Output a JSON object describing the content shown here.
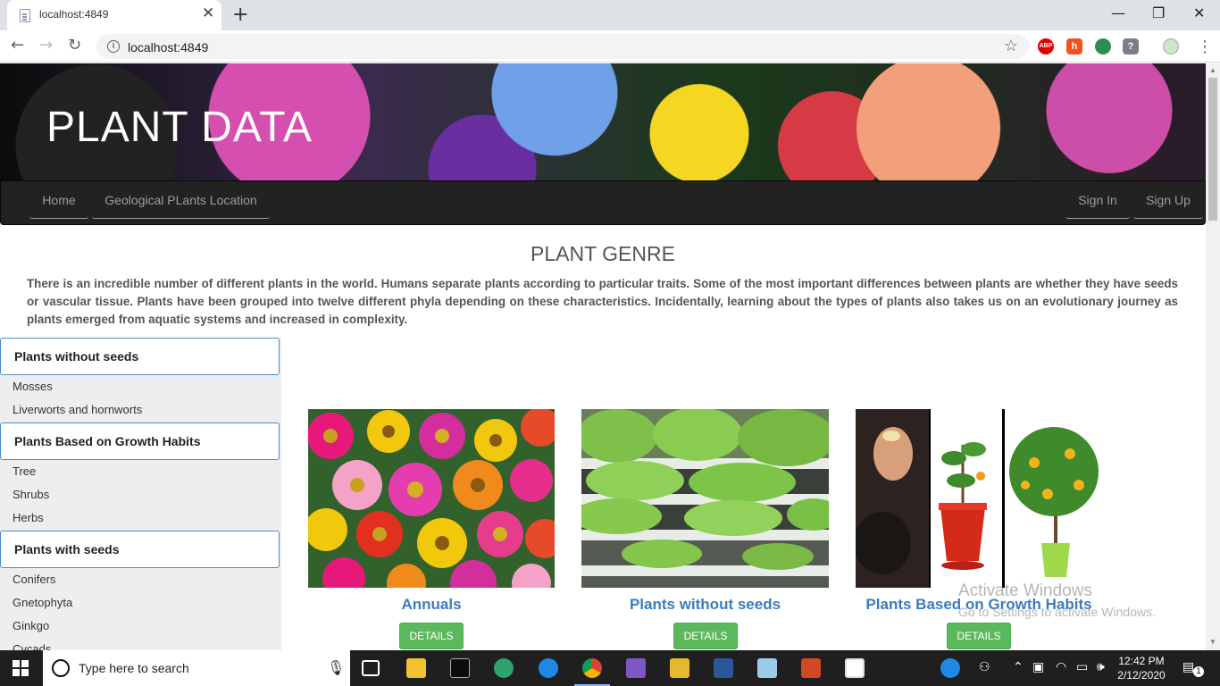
{
  "browser": {
    "tab_title": "localhost:4849",
    "url": "localhost:4849",
    "tab_close": "✕",
    "new_tab": "+",
    "back": "←",
    "forward": "→",
    "reload": "↻",
    "star": "☆",
    "menu": "⋮",
    "minimize": "—",
    "maximize": "❐",
    "close": "✕",
    "extensions": [
      {
        "name": "abp-icon",
        "label": "ABP",
        "color": "#e20000"
      },
      {
        "name": "honey-icon",
        "label": "h",
        "color": "#f4511e"
      },
      {
        "name": "globe-extension-icon",
        "label": "",
        "color": "#2e8b57"
      },
      {
        "name": "shield-extension-icon",
        "label": "?",
        "color": "#7a7f87"
      }
    ]
  },
  "site": {
    "banner_title": "PLANT DATA",
    "nav_left": [
      "Home",
      "Geological PLants Location"
    ],
    "nav_right": [
      "Sign In",
      "Sign Up"
    ]
  },
  "genre": {
    "title": "PLANT GENRE",
    "description": "There is an incredible number of different plants in the world. Humans separate plants according to particular traits. Some of the most important differences between plants are whether they have seeds or vascular tissue. Plants have been grouped into twelve different phyla depending on these characteristics. Incidentally, learning about the types of plants also takes us on an evolutionary journey as plants emerged from aquatic systems and increased in complexity."
  },
  "sidebar": {
    "groups": [
      {
        "heading": "Plants without seeds",
        "items": [
          "Mosses",
          "Liverworts and hornworts"
        ]
      },
      {
        "heading": "Plants Based on Growth Habits",
        "items": [
          "Tree",
          "Shrubs",
          "Herbs"
        ]
      },
      {
        "heading": "Plants with seeds",
        "items": [
          "Conifers",
          "Gnetophyta",
          "Ginkgo",
          "Cycads"
        ]
      }
    ]
  },
  "cards": [
    {
      "title": "Annuals",
      "button": "DETAILS"
    },
    {
      "title": "Plants without seeds",
      "button": "DETAILS"
    },
    {
      "title": "Plants Based on Growth Habits",
      "button": "DETAILS"
    }
  ],
  "watermark": {
    "line1": "Activate Windows",
    "line2": "Go to Settings to activate Windows."
  },
  "taskbar": {
    "search_placeholder": "Type here to search",
    "time": "12:42 PM",
    "date": "2/12/2020",
    "notification_count": "1",
    "apps": [
      "task-view-icon",
      "file-explorer-icon",
      "terminal-icon",
      "atom-icon",
      "edge-icon",
      "chrome-icon",
      "visual-studio-icon",
      "file-tool-icon",
      "word-icon",
      "notepad-icon",
      "powerpoint-icon",
      "photos-icon"
    ]
  }
}
